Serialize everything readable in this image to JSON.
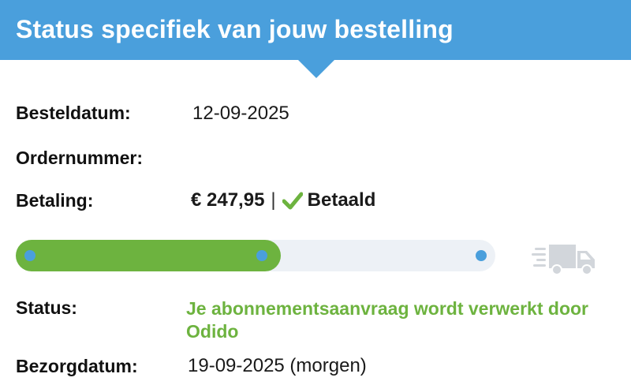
{
  "header": {
    "title": "Status specifiek van jouw bestelling"
  },
  "order": {
    "date_label": "Besteldatum:",
    "date_value": "12-09-2025",
    "number_label": "Ordernummer:",
    "number_value": "",
    "payment_label": "Betaling:",
    "payment_amount": "€ 247,95",
    "payment_separator": "|",
    "payment_status": "Betaald",
    "payment_status_icon": "checkmark-icon"
  },
  "progress": {
    "fraction": 0.5,
    "steps": 3,
    "current_step": 2,
    "end_icon": "delivery-truck-icon"
  },
  "status": {
    "label": "Status:",
    "value": "Je abonnementsaanvraag wordt verwerkt door Odido"
  },
  "delivery": {
    "label": "Bezorgdatum:",
    "value": "19-09-2025 (morgen)"
  },
  "colors": {
    "header": "#4a9fdc",
    "progress_fill": "#6db33f",
    "progress_track": "#edf1f6",
    "progress_dot": "#4a9fdc",
    "status_text": "#6db33f",
    "check": "#6db33f"
  }
}
